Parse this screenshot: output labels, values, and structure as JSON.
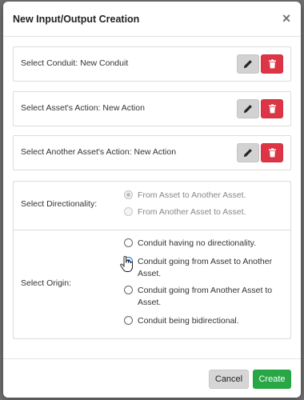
{
  "dialog": {
    "title": "New Input/Output Creation",
    "close_symbol": "×"
  },
  "rows": [
    {
      "label": "Select Conduit: New Conduit",
      "edit_icon": "pencil-icon",
      "delete_icon": "trash-icon"
    },
    {
      "label": "Select Asset's Action: New Action",
      "edit_icon": "pencil-icon",
      "delete_icon": "trash-icon"
    },
    {
      "label": "Select Another Asset's Action: New Action",
      "edit_icon": "pencil-icon",
      "delete_icon": "trash-icon"
    }
  ],
  "directionality": {
    "label": "Select Directionality:",
    "options": [
      {
        "text": "From Asset to Another Asset.",
        "checked": true,
        "disabled": true
      },
      {
        "text": "From Another Asset to Asset.",
        "checked": false,
        "disabled": true
      }
    ]
  },
  "origin": {
    "label": "Select Origin:",
    "options": [
      {
        "text": "Conduit having no directionality.",
        "checked": false
      },
      {
        "text": "Conduit going from Asset to Another Asset.",
        "checked": true
      },
      {
        "text": "Conduit going from Another Asset to Asset.",
        "checked": false
      },
      {
        "text": "Conduit being bidirectional.",
        "checked": false
      }
    ]
  },
  "footer": {
    "cancel_label": "Cancel",
    "create_label": "Create"
  },
  "colors": {
    "delete": "#dc3545",
    "create": "#28a745",
    "selected_radio": "#1a73e8"
  }
}
